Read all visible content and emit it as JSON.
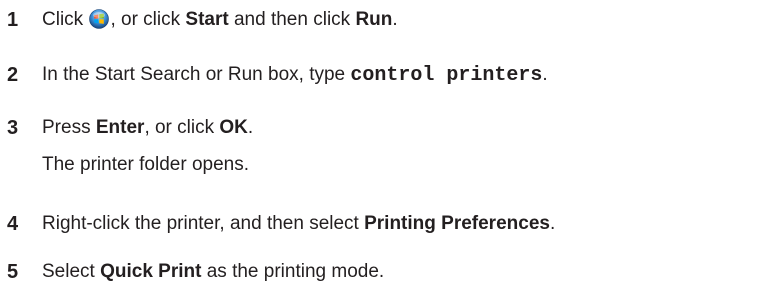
{
  "steps": [
    {
      "number": "1",
      "prefix": "Click ",
      "icon": "windows-start-orb-icon",
      "middle": ", or click ",
      "bold1": "Start",
      "middle2": " and then click ",
      "bold2": "Run",
      "suffix": "."
    },
    {
      "number": "2",
      "prefix": "In the Start Search or Run box, type ",
      "code": "control printers",
      "suffix": "."
    },
    {
      "number": "3",
      "prefix": "Press ",
      "bold1": "Enter",
      "middle": ", or click ",
      "bold2": "OK",
      "suffix": ".",
      "note": "The printer folder opens."
    },
    {
      "number": "4",
      "prefix": "Right-click the printer, and then select ",
      "bold1": "Printing Preferences",
      "suffix": "."
    },
    {
      "number": "5",
      "prefix": "Select ",
      "bold1": "Quick Print",
      "suffix": " as the printing mode."
    }
  ]
}
